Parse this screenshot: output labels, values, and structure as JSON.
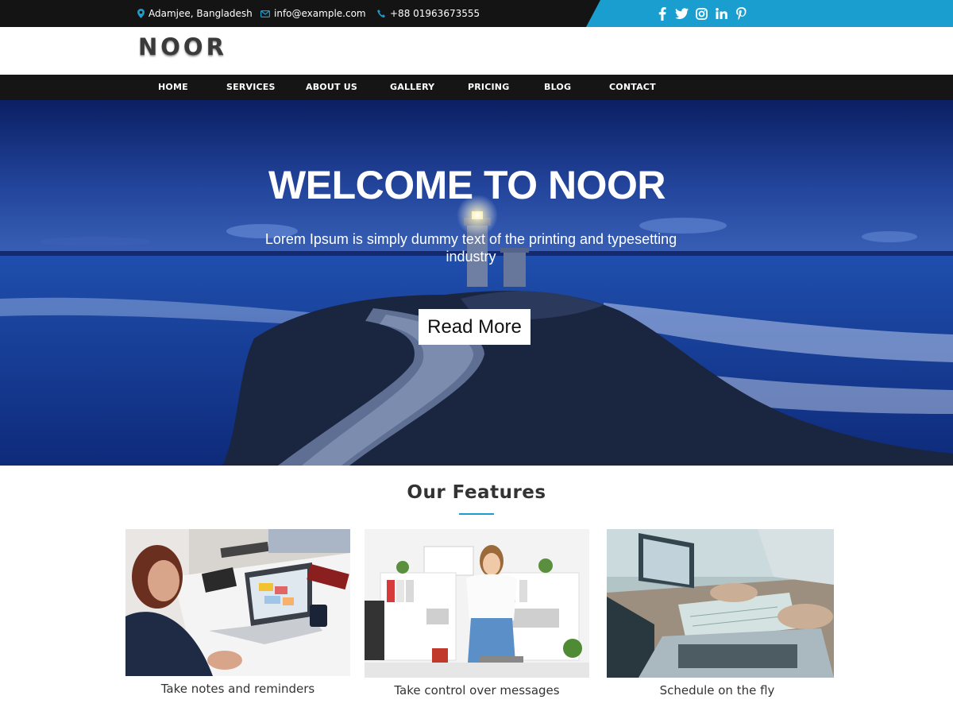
{
  "topbar": {
    "address": "Adamjee, Bangladesh",
    "email": "info@example.com",
    "phone": "+88 01963673555",
    "social_icons": [
      "facebook-icon",
      "twitter-icon",
      "instagram-icon",
      "linkedin-icon",
      "pinterest-icon"
    ],
    "accent_color": "#1a9ed0"
  },
  "logo": {
    "text": "NOOR"
  },
  "nav": {
    "items": [
      {
        "label": "HOME"
      },
      {
        "label": "SERVICES"
      },
      {
        "label": "ABOUT US"
      },
      {
        "label": "GALLERY"
      },
      {
        "label": "PRICING"
      },
      {
        "label": "BLOG"
      },
      {
        "label": "CONTACT"
      }
    ]
  },
  "hero": {
    "title": "WELCOME TO NOOR",
    "subtitle": "Lorem Ipsum is simply dummy text of the printing and typesetting industry",
    "button_label": "Read More"
  },
  "features": {
    "title": "Our Features",
    "cards": [
      {
        "caption": "Take notes and reminders"
      },
      {
        "caption": "Take control over messages"
      },
      {
        "caption": "Schedule on the fly"
      }
    ]
  }
}
